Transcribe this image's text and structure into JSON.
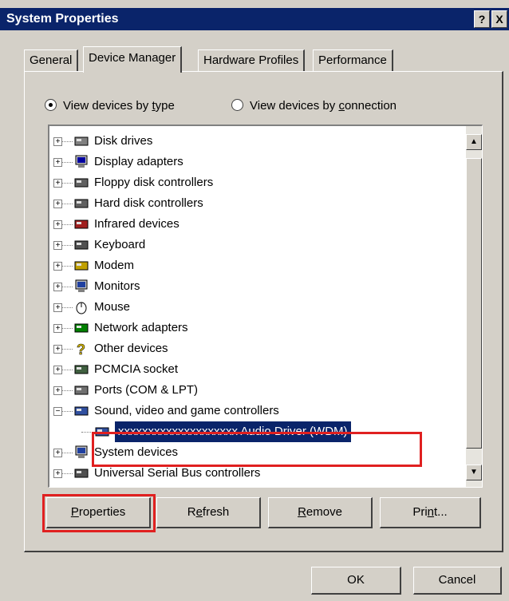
{
  "window": {
    "title": "System Properties",
    "help_glyph": "?",
    "close_glyph": "X"
  },
  "tabs": [
    {
      "label": "General",
      "active": false
    },
    {
      "label": "Device Manager",
      "active": true
    },
    {
      "label": "Hardware Profiles",
      "active": false
    },
    {
      "label": "Performance",
      "active": false
    }
  ],
  "view_options": {
    "by_type_pre": "View devices by ",
    "by_type_key": "t",
    "by_type_post": "ype",
    "by_connection_pre": "View devices by ",
    "by_connection_key": "c",
    "by_connection_post": "onnection",
    "selected": "by_type"
  },
  "device_tree": [
    {
      "label": "Disk drives",
      "icon": "disk-drive-icon",
      "expanded": false
    },
    {
      "label": "Display adapters",
      "icon": "display-adapter-icon",
      "expanded": false
    },
    {
      "label": "Floppy disk controllers",
      "icon": "floppy-controller-icon",
      "expanded": false
    },
    {
      "label": "Hard disk controllers",
      "icon": "hard-disk-controller-icon",
      "expanded": false
    },
    {
      "label": "Infrared devices",
      "icon": "infrared-icon",
      "expanded": false
    },
    {
      "label": "Keyboard",
      "icon": "keyboard-icon",
      "expanded": false
    },
    {
      "label": "Modem",
      "icon": "modem-icon",
      "expanded": false
    },
    {
      "label": "Monitors",
      "icon": "monitor-icon",
      "expanded": false
    },
    {
      "label": "Mouse",
      "icon": "mouse-icon",
      "expanded": false
    },
    {
      "label": "Network adapters",
      "icon": "network-adapter-icon",
      "expanded": false
    },
    {
      "label": "Other devices",
      "icon": "question-mark-icon",
      "expanded": false
    },
    {
      "label": "PCMCIA socket",
      "icon": "pcmcia-icon",
      "expanded": false
    },
    {
      "label": "Ports (COM & LPT)",
      "icon": "port-icon",
      "expanded": false
    },
    {
      "label": "Sound, video and game controllers",
      "icon": "sound-controller-icon",
      "expanded": true
    },
    {
      "label": "xxxxxxxxxxxxxxxxxxxx  Audio Driver (WDM)",
      "icon": "audio-driver-icon",
      "child": true,
      "selected": true
    },
    {
      "label": "System devices",
      "icon": "system-device-icon",
      "expanded": false
    },
    {
      "label": "Universal Serial Bus controllers",
      "icon": "usb-icon",
      "expanded": false
    }
  ],
  "buttons": {
    "properties_key": "P",
    "properties_rest": "roperties",
    "refresh_pre": "R",
    "refresh_key": "e",
    "refresh_post": "fresh",
    "remove_key": "R",
    "remove_post": "emove",
    "print_pre": "Pri",
    "print_key": "n",
    "print_post": "t...",
    "ok": "OK",
    "cancel": "Cancel"
  },
  "colors": {
    "title_bar": "#0a246a",
    "selection": "#0a246a",
    "face": "#d4d0c8",
    "highlight_box": "#e02020"
  }
}
